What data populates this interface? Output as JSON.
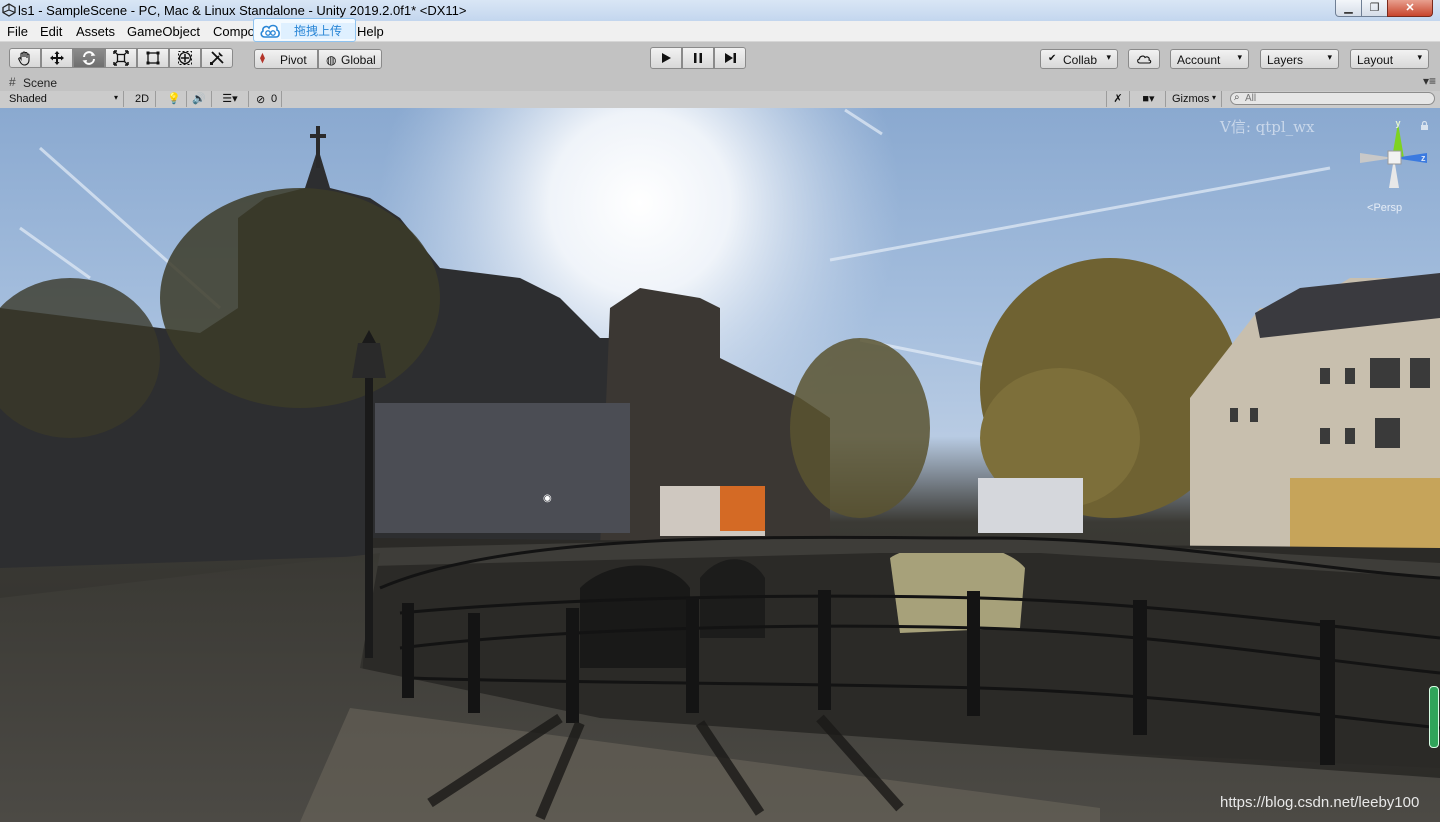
{
  "window": {
    "title": "ls1 - SampleScene - PC, Mac & Linux Standalone - Unity 2019.2.0f1* <DX11>",
    "minimize_icon": "minimize-icon",
    "maximize_icon": "restore-icon",
    "close_icon": "close-icon"
  },
  "menubar": {
    "items": [
      "File",
      "Edit",
      "Assets",
      "GameObject",
      "Compo",
      "Help"
    ]
  },
  "upload_tip": {
    "label": "拖拽上传",
    "icon": "cloud-icon"
  },
  "toolbar": {
    "tools": [
      "hand-tool-icon",
      "move-tool-icon",
      "rotate-tool-icon",
      "scale-tool-icon",
      "rect-tool-icon",
      "transform-tool-icon",
      "custom-tool-icon"
    ],
    "active_tool": "rotate-tool-icon",
    "pivot_label": "Pivot",
    "global_label": "Global",
    "play_icon": "play-icon",
    "pause_icon": "pause-icon",
    "step_icon": "step-icon",
    "collab_label": "Collab",
    "cloud_icon": "cloud-services-icon",
    "account_label": "Account",
    "layers_label": "Layers",
    "layout_label": "Layout"
  },
  "scene_tab": {
    "label": "Scene",
    "icon": "scene-grid-icon"
  },
  "scene_strip": {
    "draw_mode": "Shaded",
    "mode_2d": "2D",
    "hidden_count": "0",
    "gizmos_label": "Gizmos",
    "search_placeholder": "All"
  },
  "scene_view": {
    "watermark": "V信: qtpl_wx",
    "credit": "https://blog.csdn.net/leeby100",
    "gizmo_axes": {
      "y": "y",
      "z": "z"
    },
    "projection_label": "Persp"
  },
  "colors": {
    "gizmo_y": "#7ed321",
    "gizmo_z": "#3b7ae0",
    "scroll_indicator": "#2fa45a",
    "upload_text": "#2a86d6"
  }
}
